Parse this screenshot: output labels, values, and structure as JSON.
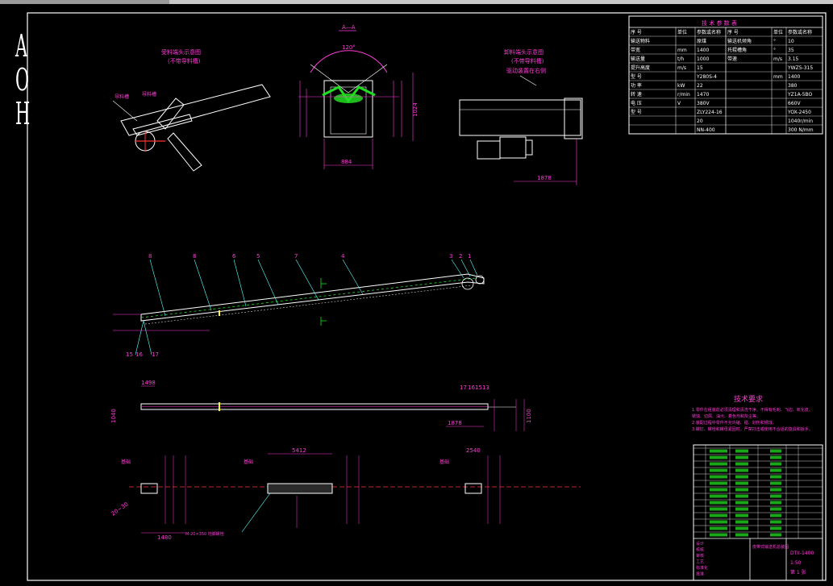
{
  "side_letters": [
    "A",
    "O",
    "H"
  ],
  "section_label": "A—A",
  "angle_label": "120°",
  "views": {
    "left_label_1": "受料端头示意图",
    "left_label_2": "(不带导料槽)",
    "right_label_1": "卸料端头示意图",
    "right_label_2": "(不带导料槽)",
    "right_label_3": "驱动装置在右侧"
  },
  "dimensions": {
    "width_884": "884",
    "dim_1878": "1878",
    "dim_1498": "1498",
    "dim_1040": "1040",
    "dim_1878b": "1878",
    "dim_1100": "1100",
    "dim_5412": "5412",
    "dim_1480": "1480",
    "dim_2540": "2540",
    "dim_20_30": "20~30",
    "dim_1024": "1024"
  },
  "part_numbers": {
    "top": [
      "8",
      "8",
      "6",
      "5",
      "7",
      "4",
      "3",
      "2",
      "1"
    ],
    "bottom_left": [
      "15",
      "16",
      "17"
    ],
    "bottom_right": [
      "17",
      "16",
      "15",
      "13"
    ]
  },
  "tech_req": {
    "title": "技术要求",
    "lines": [
      "1.零件在组装前必须清理和清洗干净，不得有毛刺、飞边、氧化皮、",
      "锈蚀、切屑、油污、着色剂和灰尘等。",
      "2.装配过程中零件不允许磕、碰、划伤和锈蚀。",
      "3.螺钉、螺栓和螺母紧固时，严禁打击或使用不合适的旋具和扳手。"
    ]
  },
  "params_table": {
    "title": "技 术 参 数 表",
    "rows": [
      [
        "序 号",
        "单位",
        "参数或名称",
        "序 号",
        "单位",
        "参数或名称"
      ],
      [
        "输送物料",
        "",
        "原煤",
        "输送机倾角",
        "°",
        "10"
      ],
      [
        "带宽",
        "mm",
        "1400",
        "托辊槽角",
        "°",
        "35"
      ],
      [
        "输送量",
        "t/h",
        "1000",
        "带速",
        "m/s",
        "3.15"
      ],
      [
        "提升高度",
        "m/s",
        "15",
        "",
        "",
        "YWZ5-315"
      ],
      [
        "型 号",
        "",
        "Y280S-4",
        "",
        "mm",
        "1400"
      ],
      [
        "功 率",
        "kW",
        "22",
        "",
        "",
        "380"
      ],
      [
        "转 速",
        "r/min",
        "1470",
        "",
        "",
        "YZ1A-5BO"
      ],
      [
        "电 压",
        "V",
        "380V",
        "",
        "",
        "660V"
      ],
      [
        "型 号",
        "",
        "ZLY224-16",
        "",
        "",
        "YOX-2450"
      ],
      [
        "",
        "",
        "20",
        "",
        "",
        "1040r/min"
      ],
      [
        "",
        "",
        "NN-400",
        "",
        "",
        "300 N/mm"
      ]
    ]
  },
  "title_block": {
    "labels": [
      "设计",
      "校核",
      "审核",
      "工艺",
      "标准化",
      "批准"
    ],
    "project": "皮带式输送机总装图",
    "drawing_title": "DTII-1400",
    "scale": "1:50",
    "sheet": "第 1 张"
  },
  "colors": {
    "magenta": "#ff3bd6",
    "white": "#ffffff",
    "green": "#22dd22",
    "cyan": "#55ffff",
    "yellow": "#ffff33",
    "red": "#ff3333",
    "blue": "#5577ff"
  }
}
